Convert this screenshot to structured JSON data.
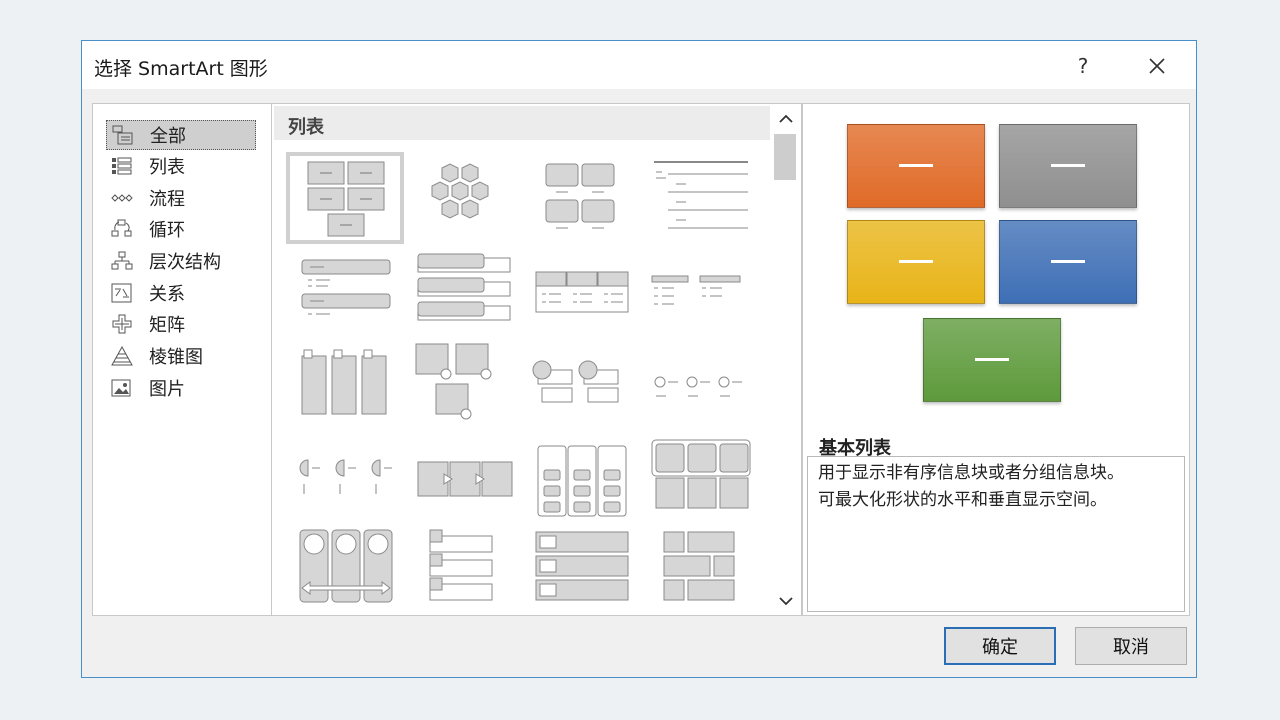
{
  "dialog": {
    "title": "选择 SmartArt 图形",
    "help_label": "?"
  },
  "categories": [
    {
      "label": "全部",
      "icon": "all-icon",
      "selected": true
    },
    {
      "label": "列表",
      "icon": "list-icon"
    },
    {
      "label": "流程",
      "icon": "process-icon"
    },
    {
      "label": "循环",
      "icon": "cycle-icon"
    },
    {
      "label": "层次结构",
      "icon": "hierarchy-icon"
    },
    {
      "label": "关系",
      "icon": "relationship-icon"
    },
    {
      "label": "矩阵",
      "icon": "matrix-icon"
    },
    {
      "label": "棱锥图",
      "icon": "pyramid-icon"
    },
    {
      "label": "图片",
      "icon": "picture-icon"
    }
  ],
  "gallery": {
    "group_label": "列表",
    "selected_index": 0
  },
  "preview": {
    "name": "基本列表",
    "description_line1": "用于显示非有序信息块或者分组信息块。",
    "description_line2": "可最大化形状的水平和垂直显示空间。",
    "colors": [
      "#e06a27",
      "#8f8f8f",
      "#e8b418",
      "#3e6fb5",
      "#5e9a3c"
    ]
  },
  "buttons": {
    "ok_label": "确定",
    "cancel_label": "取消"
  }
}
